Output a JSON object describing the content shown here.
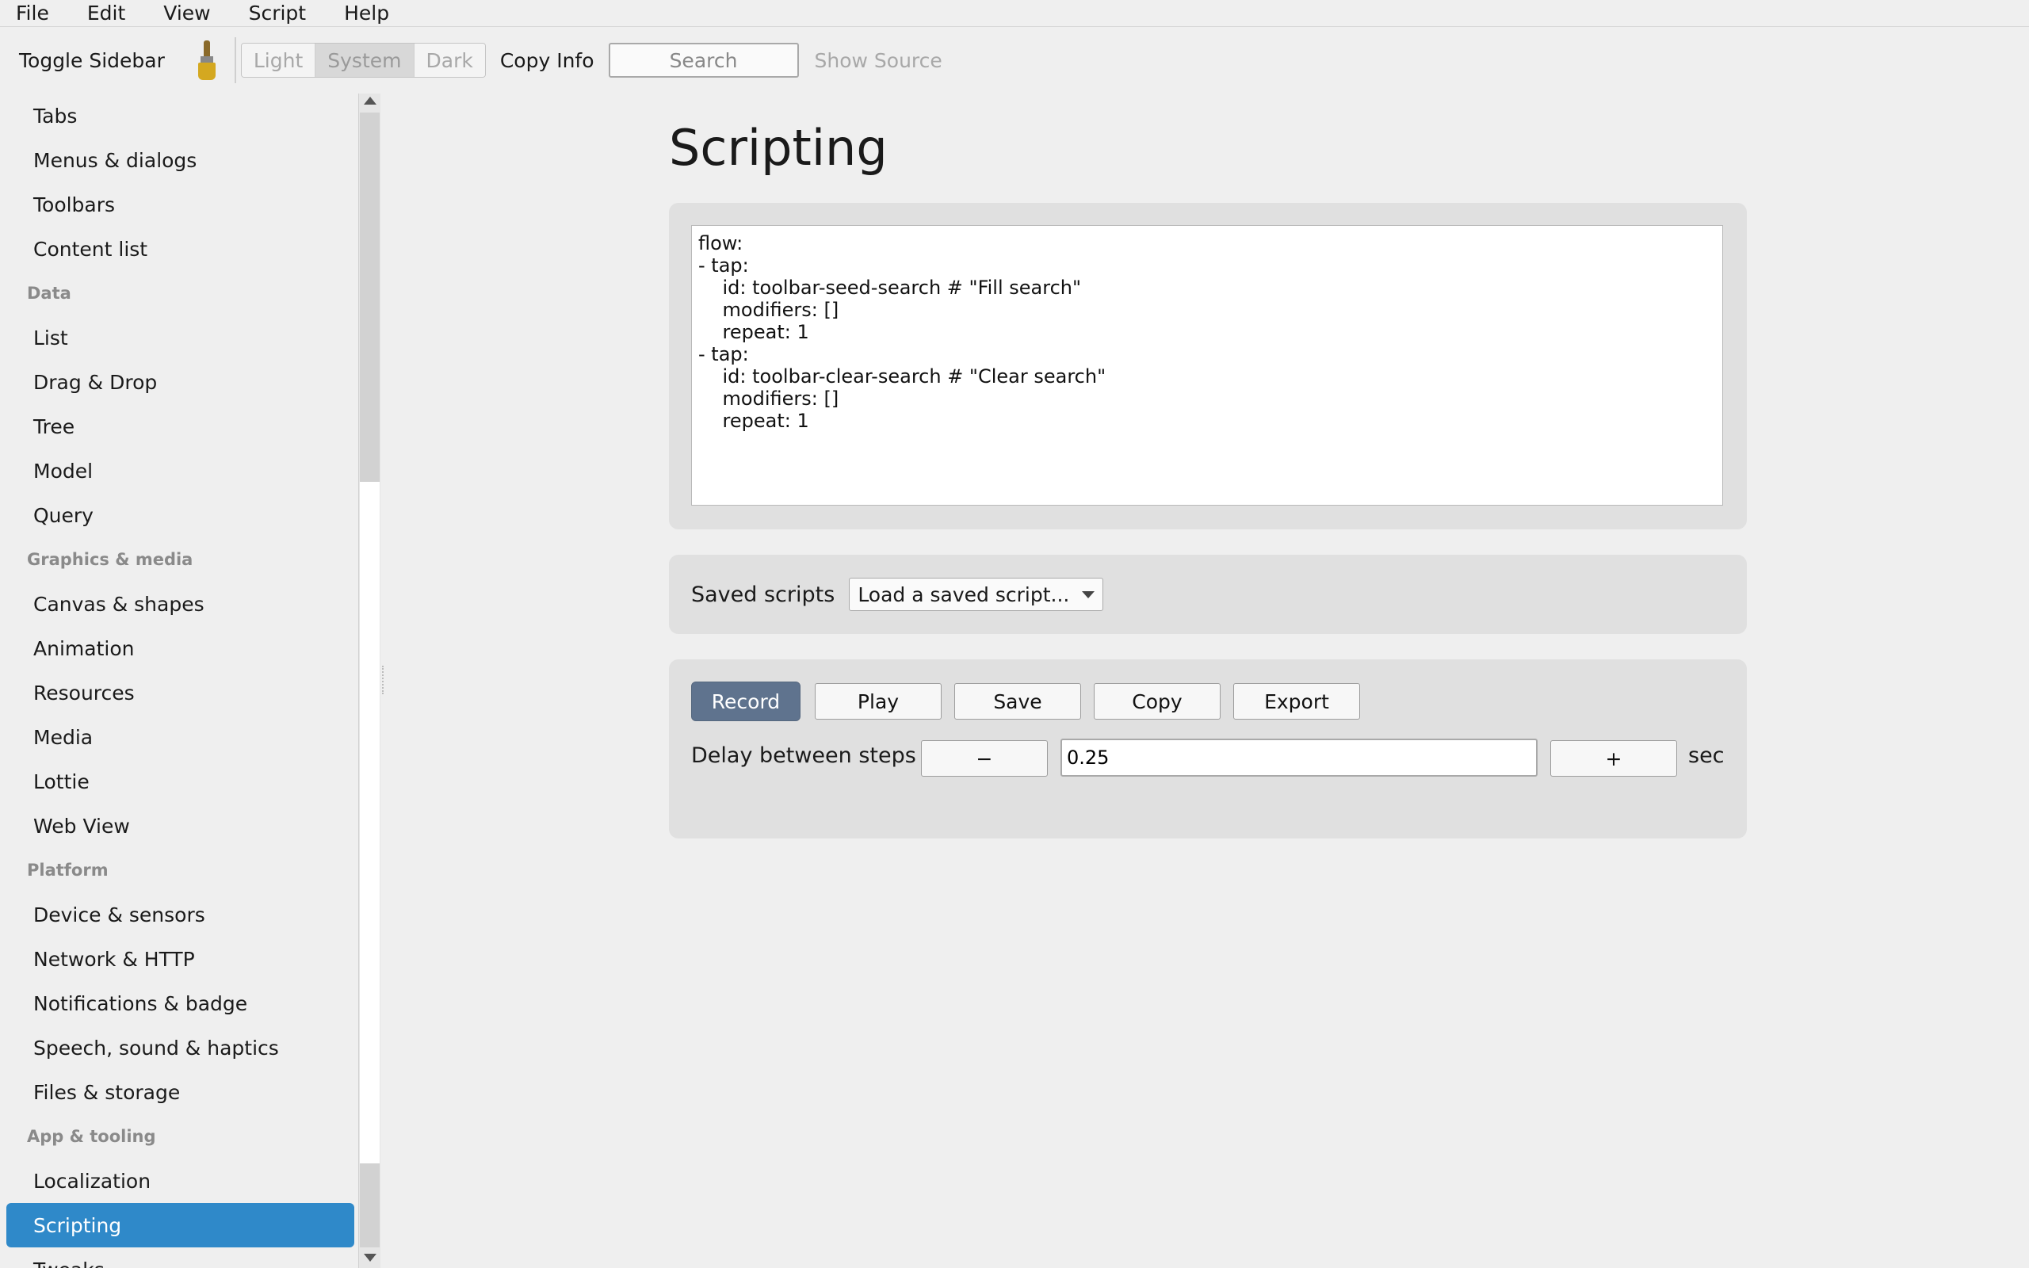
{
  "menubar": {
    "items": [
      "File",
      "Edit",
      "View",
      "Script",
      "Help"
    ]
  },
  "toolbar": {
    "toggle_sidebar": "Toggle Sidebar",
    "theme": {
      "options": [
        "Light",
        "System",
        "Dark"
      ],
      "selected": "System"
    },
    "copy_info": "Copy Info",
    "search_placeholder": "Search",
    "show_source": "Show Source"
  },
  "sidebar": {
    "entries": [
      {
        "type": "item",
        "label": "Tabs"
      },
      {
        "type": "item",
        "label": "Menus & dialogs"
      },
      {
        "type": "item",
        "label": "Toolbars"
      },
      {
        "type": "item",
        "label": "Content list"
      },
      {
        "type": "section",
        "label": "Data"
      },
      {
        "type": "item",
        "label": "List"
      },
      {
        "type": "item",
        "label": "Drag & Drop"
      },
      {
        "type": "item",
        "label": "Tree"
      },
      {
        "type": "item",
        "label": "Model"
      },
      {
        "type": "item",
        "label": "Query"
      },
      {
        "type": "section",
        "label": "Graphics & media"
      },
      {
        "type": "item",
        "label": "Canvas & shapes"
      },
      {
        "type": "item",
        "label": "Animation"
      },
      {
        "type": "item",
        "label": "Resources"
      },
      {
        "type": "item",
        "label": "Media"
      },
      {
        "type": "item",
        "label": "Lottie"
      },
      {
        "type": "item",
        "label": "Web View"
      },
      {
        "type": "section",
        "label": "Platform"
      },
      {
        "type": "item",
        "label": "Device & sensors"
      },
      {
        "type": "item",
        "label": "Network & HTTP"
      },
      {
        "type": "item",
        "label": "Notifications & badge"
      },
      {
        "type": "item",
        "label": "Speech, sound & haptics"
      },
      {
        "type": "item",
        "label": "Files & storage"
      },
      {
        "type": "section",
        "label": "App & tooling"
      },
      {
        "type": "item",
        "label": "Localization"
      },
      {
        "type": "item",
        "label": "Scripting",
        "selected": true
      },
      {
        "type": "item",
        "label": "Tweaks"
      }
    ],
    "selected_color": "#2f89c9"
  },
  "main": {
    "title": "Scripting",
    "script_text": "flow:\n- tap:\n    id: toolbar-seed-search # \"Fill search\"\n    modifiers: []\n    repeat: 1\n- tap:\n    id: toolbar-clear-search # \"Clear search\"\n    modifiers: []\n    repeat: 1",
    "saved_scripts": {
      "label": "Saved scripts",
      "selected": "Load a saved script..."
    },
    "controls": {
      "record": "Record",
      "play": "Play",
      "save": "Save",
      "copy": "Copy",
      "export": "Export",
      "delay_label": "Delay between steps",
      "decrement": "−",
      "delay_value": "0.25",
      "increment": "+",
      "unit": "sec"
    },
    "record_color": "#5f738e"
  }
}
